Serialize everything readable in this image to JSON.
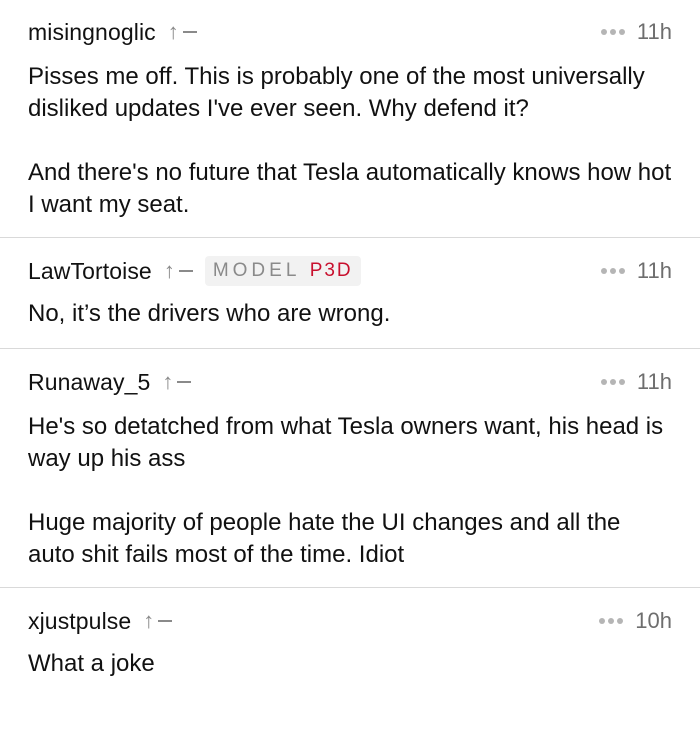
{
  "comments": [
    {
      "username": "misingnoglic",
      "time": "11h",
      "paragraphs": [
        "Pisses me off. This is probably one of the most universally disliked updates I've ever seen. Why defend it?",
        "And there's no future that Tesla automatically knows how hot I want my seat."
      ]
    },
    {
      "username": "LawTortoise",
      "flair": {
        "text": "MODEL",
        "accent": "P3D"
      },
      "time": "11h",
      "paragraphs": [
        "No, it’s the drivers who are wrong."
      ]
    },
    {
      "username": "Runaway_5",
      "time": "11h",
      "paragraphs": [
        "He's so detatched from what Tesla owners want, his head is way up his ass",
        "Huge majority of people hate the UI changes and all the auto shit fails most of the time. Idiot"
      ]
    },
    {
      "username": "xjustpulse",
      "time": "10h",
      "paragraphs": [
        "What a joke"
      ]
    }
  ],
  "icons": {
    "upvote": "arrow-up-icon",
    "more": "more-options-icon"
  },
  "colors": {
    "text": "#111111",
    "muted": "#8a8a8a",
    "divider": "#d9d9d9",
    "flair_accent": "#c8102e"
  }
}
